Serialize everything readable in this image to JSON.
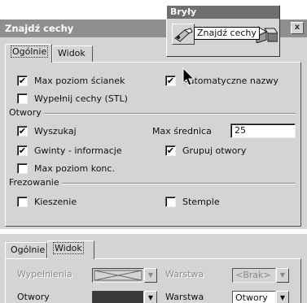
{
  "dialog": {
    "title": "Znajdź cechy",
    "close_glyph": "x",
    "tabs": [
      {
        "label": "Ogólnie",
        "active": true
      },
      {
        "label": "Widok",
        "active": false
      }
    ],
    "general": {
      "options": [
        {
          "label": "Max poziom ścianek",
          "checked": true
        },
        {
          "label": "Automatyczne nazwy",
          "checked": true
        },
        {
          "label": "Wypełnij cechy (STL)",
          "checked": false
        }
      ],
      "holes_group": {
        "label": "Otwory",
        "options": [
          {
            "label": "Wyszukaj",
            "checked": true
          },
          {
            "label": "Gwinty - informacje",
            "checked": true
          },
          {
            "label": "Grupuj otwory",
            "checked": true
          },
          {
            "label": "Max poziom konc.",
            "checked": false
          }
        ],
        "max_diameter_label": "Max średnica",
        "max_diameter_value": "25"
      },
      "milling_group": {
        "label": "Frezowanie",
        "options": [
          {
            "label": "Kieszenie",
            "checked": false
          },
          {
            "label": "Stemple",
            "checked": false
          }
        ]
      }
    }
  },
  "toolbar": {
    "title": "Bryły",
    "tooltip": "Znajdź cechy",
    "icon": "find-features-icon"
  },
  "dialog2": {
    "tabs": [
      {
        "label": "Ogólnie",
        "active": false
      },
      {
        "label": "Widok",
        "active": true
      }
    ],
    "rows": [
      {
        "label": "Wypełnienia",
        "layer_label": "Warstwa",
        "layer_value": "<Brak>",
        "disabled": true
      },
      {
        "label": "Otwory",
        "layer_label": "Warstwa",
        "layer_value": "Otwory",
        "disabled": false
      }
    ]
  },
  "check_glyph": "✔",
  "dropdown_glyph": "▼"
}
